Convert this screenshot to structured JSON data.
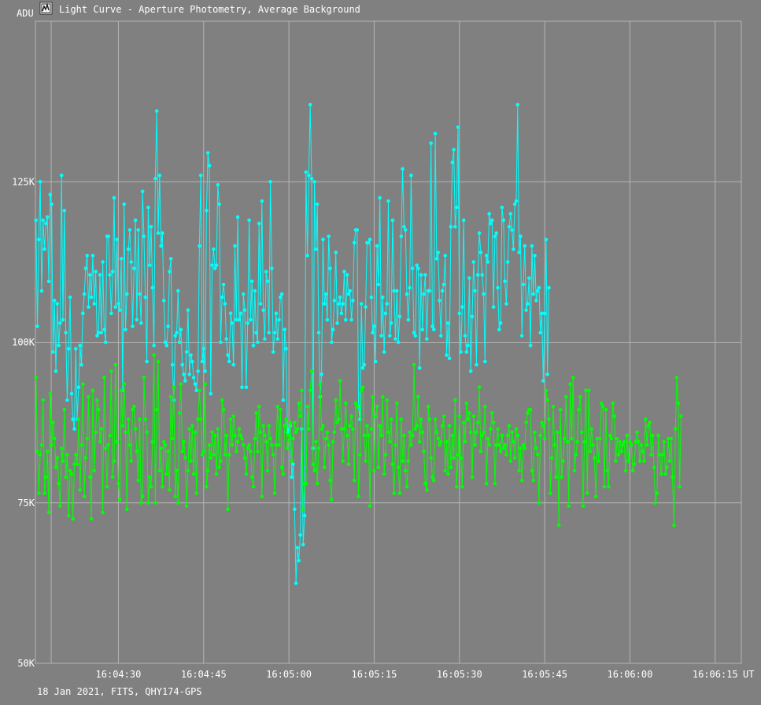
{
  "window": {
    "title": "Light Curve - Aperture Photometry, Average Background",
    "icon": "light-curve-icon",
    "footer": "18 Jan 2021, FITS, QHY174-GPS"
  },
  "chart_data": {
    "type": "line",
    "title": "Light Curve - Aperture Photometry, Average Background",
    "ylabel": "ADU",
    "xlabel": "UT",
    "ylim": [
      50000,
      150000
    ],
    "y_ticks": [
      {
        "value": 50000,
        "label": "50K"
      },
      {
        "value": 75000,
        "label": "75K"
      },
      {
        "value": 100000,
        "label": "100K"
      },
      {
        "value": 125000,
        "label": "125K"
      }
    ],
    "x_range_seconds": [
      "16:04:15.4",
      "16:06:19.6"
    ],
    "x_ticks": [
      "16:04:30",
      "16:04:45",
      "16:05:00",
      "16:05:15",
      "16:05:30",
      "16:05:45",
      "16:06:00",
      "16:06:15"
    ],
    "grid": true,
    "colors": {
      "background": "#808080",
      "grid": "#b4b4b4",
      "text": "#ffffff",
      "aperture": "#00ffff",
      "background_series": "#00ff00"
    },
    "series": [
      {
        "key": "aperture",
        "color": "#00ffff",
        "sample_every_s": 0.25,
        "start": "16:04:15.5",
        "values": [
          119000,
          102500,
          116000,
          125000,
          108000,
          119000,
          114500,
          118500,
          119500,
          109500,
          123000,
          121500,
          98500,
          106500,
          95500,
          106000,
          99500,
          103000,
          126000,
          103500,
          120500,
          101500,
          91000,
          99000,
          107000,
          92000,
          88000,
          86500,
          99000,
          88000,
          93000,
          99500,
          96500,
          104500,
          107500,
          111500,
          113500,
          105500,
          110500,
          107000,
          113500,
          106000,
          111000,
          101000,
          101500,
          110500,
          101500,
          112500,
          102000,
          100000,
          116500,
          116500,
          110500,
          104500,
          111000,
          122500,
          105500,
          116000,
          106000,
          105000,
          113000,
          92500,
          121500,
          102000,
          107500,
          114500,
          117500,
          112500,
          102500,
          111500,
          119000,
          103500,
          117500,
          107500,
          103000,
          123500,
          116500,
          107000,
          97000,
          121000,
          112000,
          118000,
          108500,
          99500,
          125500,
          136000,
          117000,
          126000,
          115000,
          117000,
          106500,
          100000,
          99500,
          102500,
          111000,
          113000,
          96500,
          91000,
          101000,
          101500,
          108000,
          100000,
          102000,
          96500,
          95000,
          94000,
          98500,
          105000,
          95000,
          98000,
          97000,
          94500,
          93500,
          92500,
          95500,
          115000,
          126000,
          97000,
          99000,
          95500,
          120500,
          129500,
          127500,
          92000,
          112000,
          114500,
          111500,
          112000,
          124500,
          121500,
          100000,
          107000,
          109000,
          106000,
          100500,
          98000,
          97000,
          104500,
          103000,
          96500,
          115000,
          103500,
          119500,
          103500,
          104500,
          93000,
          107500,
          105000,
          93000,
          103000,
          119000,
          103500,
          109500,
          99500,
          108000,
          101500,
          100000,
          118500,
          106000,
          122000,
          105000,
          100500,
          111000,
          109500,
          101500,
          125000,
          111500,
          98500,
          101500,
          104500,
          100500,
          103500,
          107000,
          107500,
          91000,
          102000,
          99000,
          86000,
          86500,
          87000,
          79000,
          81000,
          74000,
          62500,
          68000,
          66000,
          70000,
          86500,
          68500,
          73000,
          126500,
          113500,
          126000,
          137000,
          125500,
          83500,
          125000,
          114500,
          121500,
          101500,
          91500,
          95000,
          116000,
          106000,
          107500,
          103500,
          116500,
          111500,
          100000,
          102000,
          106500,
          114000,
          103000,
          106000,
          107000,
          104500,
          106000,
          111000,
          103500,
          110500,
          107500,
          108000,
          103500,
          106500,
          115500,
          117500,
          117500,
          90000,
          88000,
          106000,
          96000,
          96500,
          105500,
          115500,
          115500,
          116000,
          107000,
          101500,
          102500,
          97000,
          115000,
          109000,
          122500,
          101000,
          107000,
          98500,
          104500,
          106000,
          122000,
          101000,
          103000,
          119000,
          108000,
          100500,
          108000,
          100000,
          104000,
          116500,
          127000,
          118000,
          117500,
          107500,
          103500,
          108500,
          126000,
          111500,
          101500,
          101000,
          112000,
          111500,
          96000,
          110500,
          102000,
          107500,
          110500,
          100500,
          108000,
          108000,
          131000,
          102500,
          102000,
          132500,
          113000,
          114000,
          106500,
          101000,
          108000,
          109000,
          113500,
          98000,
          103000,
          97500,
          118000,
          128000,
          130000,
          118000,
          121000,
          133500,
          104500,
          98500,
          105500,
          119000,
          101000,
          98500,
          99500,
          110000,
          95500,
          104000,
          112500,
          108000,
          96500,
          110500,
          117000,
          114000,
          110500,
          107500,
          97000,
          113500,
          112500,
          120000,
          118500,
          119000,
          105500,
          116500,
          117000,
          108500,
          102000,
          103000,
          121000,
          119000,
          109500,
          106000,
          112500,
          118000,
          120000,
          117500,
          114500,
          121500,
          122000,
          137000,
          114000,
          116500,
          101000,
          109000,
          115000,
          105000,
          106000,
          110000,
          99500,
          115000,
          107500,
          113500,
          106500,
          108000,
          108500,
          101500,
          104500,
          94000,
          104500,
          116000,
          95000,
          108500
        ]
      },
      {
        "key": "background",
        "color": "#00ff00",
        "sample_every_s": 0.25,
        "start": "16:04:15.5",
        "values": [
          94500,
          83000,
          76500,
          82500,
          84000,
          91000,
          76500,
          79000,
          83000,
          73500,
          92000,
          84000,
          87500,
          85000,
          80500,
          82000,
          78000,
          74500,
          83500,
          81500,
          89500,
          79000,
          82500,
          73000,
          80000,
          79500,
          72500,
          81000,
          82500,
          81000,
          88000,
          77000,
          84000,
          93500,
          76000,
          82000,
          85000,
          91500,
          79000,
          72500,
          92500,
          80000,
          86000,
          91000,
          89500,
          84500,
          86500,
          73500,
          94500,
          83500,
          77500,
          84000,
          85500,
          95500,
          79000,
          81500,
          96500,
          84500,
          78000,
          75500,
          92500,
          87000,
          93500,
          86000,
          74000,
          88000,
          84000,
          81500,
          89500,
          90000,
          86500,
          83000,
          78500,
          88000,
          75000,
          76000,
          94500,
          88000,
          86000,
          75000,
          79000,
          77500,
          84500,
          98000,
          75000,
          89500,
          97000,
          80000,
          83500,
          77500,
          84500,
          84000,
          79500,
          83000,
          77000,
          91500,
          85000,
          93000,
          76000,
          80000,
          75000,
          89000,
          93500,
          83000,
          84500,
          82000,
          74500,
          80000,
          86500,
          81500,
          87000,
          79500,
          86000,
          76500,
          88000,
          92500,
          88000,
          82500,
          83000,
          93500,
          77500,
          80000,
          84000,
          82000,
          86000,
          82500,
          85500,
          79500,
          86500,
          80500,
          81500,
          91000,
          89500,
          82500,
          85500,
          74000,
          82500,
          88000,
          84000,
          88500,
          85500,
          83000,
          84500,
          86500,
          85500,
          85000,
          84000,
          82000,
          79500,
          83500,
          84000,
          83000,
          79000,
          77500,
          85000,
          89000,
          83000,
          90000,
          86000,
          76000,
          87000,
          85500,
          84500,
          80000,
          87000,
          85000,
          84000,
          82500,
          76500,
          84000,
          90000,
          84000,
          89500,
          80500,
          79500,
          87000,
          88000,
          83500,
          85500,
          87500,
          81500,
          85000,
          87500,
          86000,
          86500,
          90500,
          88500,
          92500,
          74000,
          78000,
          78000,
          90000,
          86500,
          92500,
          95500,
          81000,
          80000,
          84500,
          78000,
          83500,
          93500,
          86500,
          87000,
          80500,
          85000,
          86000,
          84000,
          78500,
          75500,
          84500,
          86000,
          91000,
          87500,
          88000,
          94000,
          86500,
          81500,
          86500,
          90500,
          85500,
          81000,
          87000,
          88500,
          86500,
          78500,
          90500,
          90000,
          76000,
          82500,
          92500,
          93000,
          85500,
          81500,
          87000,
          85500,
          74500,
          86500,
          91500,
          80000,
          88500,
          90000,
          80500,
          87000,
          85500,
          91500,
          79500,
          82500,
          91000,
          86000,
          84500,
          88000,
          81000,
          76500,
          84000,
          90500,
          80500,
          76500,
          88000,
          81500,
          85500,
          80000,
          77500,
          81500,
          86000,
          84000,
          85500,
          96500,
          86500,
          87000,
          91500,
          84500,
          88000,
          86000,
          83000,
          78000,
          77000,
          90000,
          88000,
          82000,
          79000,
          78500,
          88000,
          86000,
          85000,
          84000,
          84500,
          87000,
          88500,
          80000,
          84500,
          79500,
          87000,
          80500,
          85500,
          82000,
          91000,
          77500,
          82500,
          88500,
          82000,
          77500,
          87500,
          84500,
          90500,
          88000,
          89000,
          86000,
          79000,
          88500,
          84000,
          86000,
          87500,
          93000,
          83000,
          85500,
          86000,
          90000,
          78000,
          85000,
          84000,
          86500,
          89000,
          87500,
          78000,
          84000,
          86500,
          84000,
          83000,
          85500,
          83500,
          84000,
          82500,
          85500,
          87000,
          81500,
          86000,
          84500,
          82000,
          86500,
          85500,
          80000,
          83500,
          78500,
          84000,
          83500,
          87500,
          89000,
          89500,
          89500,
          80000,
          78500,
          86000,
          83500,
          82500,
          75000,
          85500,
          87500,
          87000,
          85000,
          92500,
          91000,
          88000,
          76500,
          82000,
          90000,
          84000,
          79000,
          86000,
          71500,
          89500,
          79000,
          81500,
          85000,
          91500,
          84500,
          74500,
          93500,
          85000,
          94500,
          80000,
          82500,
          84500,
          89500,
          91500,
          86000,
          74500,
          84500,
          92500,
          76500,
          92500,
          83000,
          86500,
          84000,
          82000,
          76000,
          85000,
          81500,
          85000,
          90500,
          90000,
          77500,
          89500,
          80000,
          77500,
          85500,
          85000,
          90500,
          88500,
          81500,
          85000,
          82500,
          84500,
          83000,
          84000,
          84500,
          80000,
          85500,
          81500,
          84500,
          84000,
          80000,
          81000,
          84500,
          86000,
          84500,
          81500,
          84000,
          83000,
          81500,
          88000,
          84000,
          87000,
          87500,
          82500,
          85500,
          80500,
          75000,
          76500,
          85500,
          82500,
          79500,
          82500,
          84500,
          79500,
          80500,
          85000,
          81500,
          85000,
          79000,
          71500,
          86500,
          94500,
          90500,
          77500,
          88500
        ]
      }
    ]
  }
}
